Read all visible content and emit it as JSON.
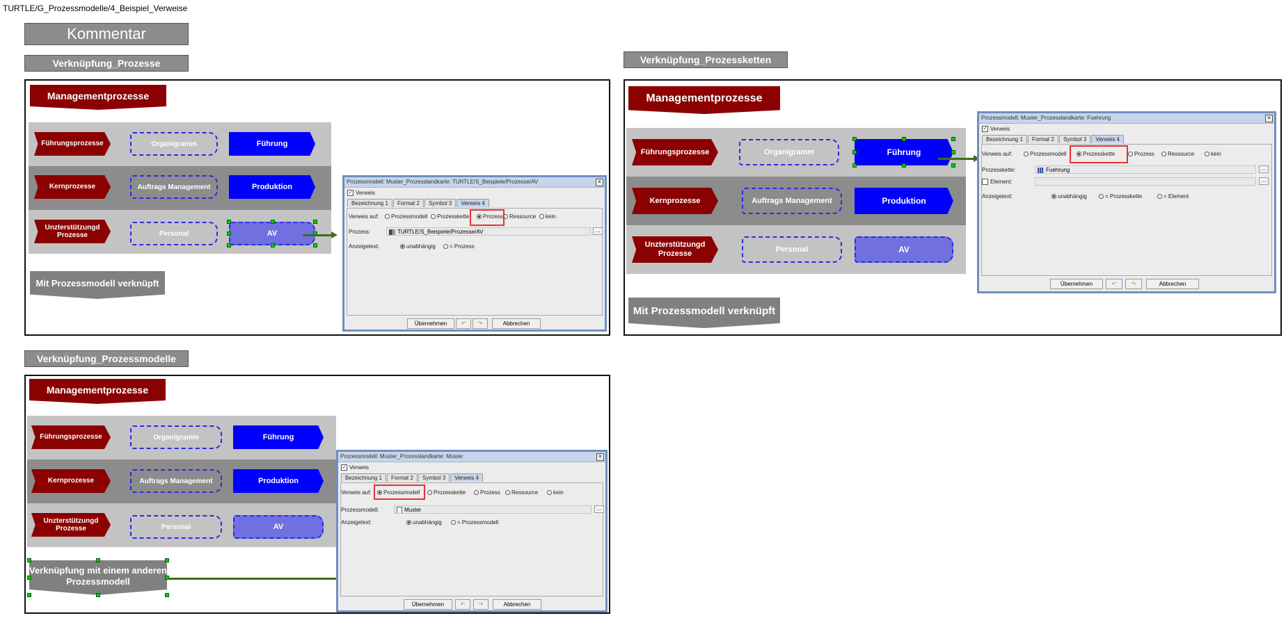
{
  "breadcrumb": "TURTLE/G_Prozessmodelle/4_Beispiel_Verweise",
  "kommentar": "Kommentar",
  "sections": {
    "prozesse": "Verknüpfung_Prozesse",
    "prozessketten": "Verknüpfung_Prozessketten",
    "prozessmodelle": "Verknüpfung_Prozessmodelle"
  },
  "map": {
    "management": "Managementprozesse",
    "rows": [
      {
        "label": "Führungsprozesse",
        "middle": "Organigramm",
        "right": "Führung"
      },
      {
        "label": "Kernprozesse",
        "middle": "Auftrags Management",
        "right": "Produktion"
      },
      {
        "label": "Unzterstützungd Prozesse",
        "middle": "Personal",
        "right": "AV"
      }
    ]
  },
  "notes": {
    "p1": "Mit Prozessmodell verknüpft",
    "p2": "Mit Prozessmodell verknüpft",
    "p3": "Verknüpfung mit einem anderen Prozessmodell"
  },
  "dialogs": {
    "d1": {
      "title": "Prozessmodell: Muster_Prozesslandkarte: TURTLE/S_Beispiele/Prozesse/AV",
      "verweis": "Verweis",
      "tabs": [
        "Bezeichnung 1",
        "Format 2",
        "Symbol 3",
        "Verweis 4"
      ],
      "verweis_auf_label": "Verweis auf:",
      "options": [
        "Prozessmodell",
        "Prozesskette",
        "Prozess",
        "Ressource",
        "kein"
      ],
      "field_label": "Prozess:",
      "field_value": "TURTLE/S_Beispiele/Prozesse/AV",
      "anzeigetext_label": "Anzeigetext:",
      "anzeige_options": [
        "unabhängig",
        "= Prozess"
      ],
      "ok": "Übernehmen",
      "cancel": "Abbrechen"
    },
    "d2": {
      "title": "Prozessmodell: Muster_Prozesslandkarte: Fuehrung",
      "verweis": "Verweis",
      "tabs": [
        "Bezeichnung 1",
        "Format 2",
        "Symbol 3",
        "Verweis 4"
      ],
      "verweis_auf_label": "Verweis auf:",
      "options": [
        "Prozessmodell",
        "Prozesskette",
        "Prozess",
        "Ressource",
        "kein"
      ],
      "field_label": "Prozesskette:",
      "field_value": "Fuehrung",
      "element_label": "Element:",
      "anzeigetext_label": "Anzeigetext:",
      "anzeige_options": [
        "unabhängig",
        "= Prozesskette",
        "= Element"
      ],
      "ok": "Übernehmen",
      "cancel": "Abbrechen"
    },
    "d3": {
      "title": "Prozessmodell: Muster_Prozesslandkarte: Muster",
      "verweis": "Verweis",
      "tabs": [
        "Bezeichnung 1",
        "Format 2",
        "Symbol 3",
        "Verweis 4"
      ],
      "verweis_auf_label": "Verweis auf:",
      "options": [
        "Prozessmodell",
        "Prozesskette",
        "Prozess",
        "Ressource",
        "kein"
      ],
      "field_label": "Prozessmodell:",
      "field_value": "Muster",
      "anzeigetext_label": "Anzeigetext:",
      "anzeige_options": [
        "unabhängig",
        "= Prozessmodell"
      ],
      "ok": "Übernehmen",
      "cancel": "Abbrechen"
    }
  },
  "colors": {
    "management_red": "#8b0000",
    "process_blue": "#0000ff",
    "av_purple": "#7070e0",
    "highlight_red": "#e53030",
    "arrow_green": "#3a6e1e"
  }
}
